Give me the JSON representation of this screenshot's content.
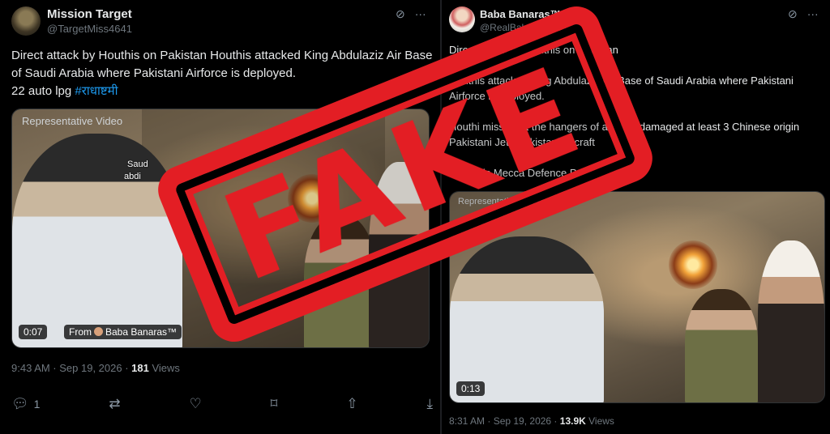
{
  "left_tweet": {
    "author_name": "Mission Target",
    "handle": "@TargetMiss4641",
    "text": "Direct attack by Houthis on Pakistan   Houthis attacked King Abdulaziz Air Base of Saudi Arabia where Pakistani Airforce is deployed.",
    "text_line2": "22 auto lpg ",
    "hashtag": "#राधाष्टमी",
    "media": {
      "label": "Representative Video",
      "map_label_1": "Saud",
      "map_label_2": "abdi",
      "duration": "0:07",
      "from_prefix": "From",
      "from_name": "Baba Banaras™"
    },
    "timestamp": "9:43 AM · Sep 19, 2026 · ",
    "views_count": "181",
    "views_label": " Views",
    "actions": {
      "reply_icon": "reply-icon",
      "reply_count": "1",
      "retweet_icon": "retweet-icon",
      "like_icon": "heart-icon",
      "bookmark_icon": "bookmark-icon",
      "share_icon": "share-icon",
      "download_icon": "download-icon"
    }
  },
  "right_tweet": {
    "author_name": "Baba Banaras™",
    "handle": "@RealBababanaras",
    "para1": "Direct attack by Houthis on Pakistan",
    "para2": "Houthis attacked King Abdulaziz Air Base of Saudi Arabia where Pakistani Airforce is deployed.",
    "para3": "Houthi missile hit the hangers of airbase damaged at least 3 Chinese origin Pakistani Jets Pakistani aircraft",
    "para4": "Where is Mecca Defence Pact",
    "media": {
      "label": "Representative Video",
      "duration": "0:13"
    },
    "timestamp": "8:31 AM · Sep 19, 2026 · ",
    "views_count": "13.9K",
    "views_label": " Views"
  },
  "stamp": {
    "text": "FAKE",
    "color": "#e31e24"
  },
  "colors": {
    "background": "#000000",
    "text": "#e7e9ea",
    "muted": "#6e767d",
    "link": "#1d9bf0"
  }
}
